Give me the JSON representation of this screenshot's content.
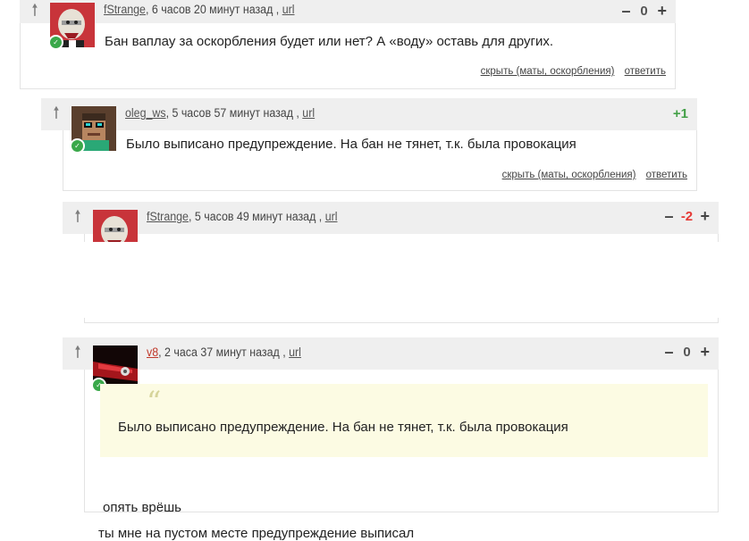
{
  "comments": [
    {
      "author": "fStrange",
      "time": ", 6 часов 20 минут назад , ",
      "link": "url",
      "score": "0",
      "text": "Бан ваплау за оскорбления будет или нет? А «воду» оставь для других.",
      "hide_label": "скрыть (маты, оскорбления)",
      "reply_label": "ответить"
    },
    {
      "author": "oleg_ws",
      "time": ", 5 часов 57 минут назад , ",
      "link": "url",
      "score": "+1",
      "text": "Было выписано предупреждение. На бан не тянет, т.к. была провокация",
      "hide_label": "скрыть (маты, оскорбления)",
      "reply_label": "ответить"
    },
    {
      "author": "fStrange",
      "time": ", 5 часов 49 минут назад , ",
      "link": "url",
      "score": "-2"
    },
    {
      "author": "v8",
      "time": ", 2 часа 37 минут назад , ",
      "link": "url",
      "score": "0",
      "quote": "Было выписано предупреждение. На бан не тянет, т.к. была провокация",
      "line1": "опять врёшь",
      "line2": "ты мне на пустом месте предупреждение выписал"
    }
  ],
  "icons": {
    "upvote": "arrow-up-icon",
    "vote_minus": "minus-icon",
    "vote_plus": "plus-icon",
    "online": "check-icon",
    "quote": "quote-icon"
  },
  "colors": {
    "header_bg": "#efefef",
    "positive": "#43a047",
    "negative": "#e53935",
    "online": "#3aa84a",
    "quote_bg": "#fcfbe3",
    "v8_author": "#c0392b"
  }
}
